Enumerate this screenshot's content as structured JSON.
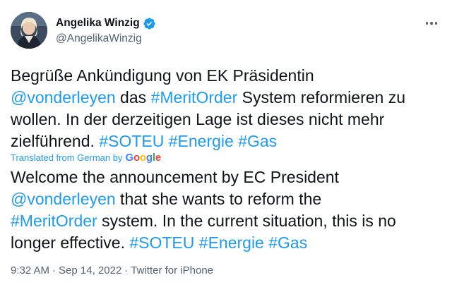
{
  "author": {
    "display_name": "Angelika Winzig",
    "handle": "@AngelikaWinzig",
    "verified_icon": "verified-badge-icon"
  },
  "more_icon": "more-horizontal-icon",
  "original": {
    "t1": "Begrüße Ankündigung von EK Präsidentin",
    "m1": "@vonderleyen",
    "t2": " das ",
    "h1": "#MeritOrder",
    "t3": " System reformieren zu wollen. In der derzeitigen Lage ist dieses nicht mehr zielführend. ",
    "h2": "#SOTEU",
    "h3": "#Energie",
    "h4": "#Gas"
  },
  "translation_note": {
    "label": "Translated from German by",
    "provider": {
      "g1": "G",
      "o1": "o",
      "o2": "o",
      "g2": "g",
      "l": "l",
      "e": "e"
    }
  },
  "translated": {
    "t1": "Welcome the announcement by EC President",
    "m1": "@vonderleyen",
    "t2": " that she wants to reform the ",
    "h1": "#MeritOrder",
    "t3": " system. In the current situation, this is no longer effective. ",
    "h2": "#SOTEU",
    "h3": "#Energie",
    "h4": "#Gas"
  },
  "meta": {
    "time": "9:32 AM",
    "separator": "·",
    "date": "Sep 14, 2022",
    "source": "Twitter for iPhone"
  },
  "colors": {
    "link": "#1d9bf0",
    "text": "#0f1419",
    "secondary": "#536471"
  }
}
